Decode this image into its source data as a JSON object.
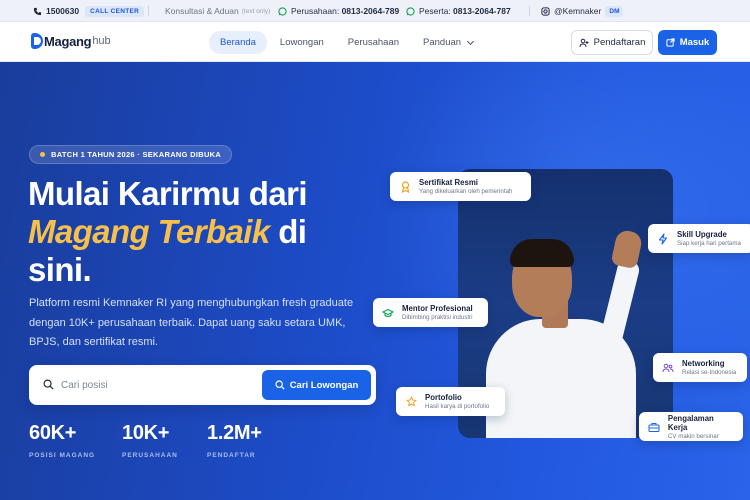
{
  "topbar": {
    "phone": "1500630",
    "call_center": "CALL CENTER",
    "consult": "Konsultasi & Aduan",
    "consult_note": "(text only)",
    "company_label": "Perusahaan:",
    "company_phone": "0813-2064-789",
    "participant_label": "Peserta:",
    "participant_phone": "0813-2064-787",
    "instagram": "@Kemnaker",
    "dm": "DM"
  },
  "navbar": {
    "logo_main": "Magang",
    "logo_sub": "hub",
    "links": [
      "Beranda",
      "Lowongan",
      "Perusahaan",
      "Panduan"
    ],
    "register": "Pendaftaran",
    "login": "Masuk"
  },
  "hero": {
    "pill": "BATCH 1 TAHUN 2026 · SEKARANG DIBUKA",
    "headline_1": "Mulai Karirmu dari",
    "headline_accent": "Magang Terbaik",
    "headline_2": "di",
    "headline_3": "sini.",
    "description": "Platform resmi Kemnaker RI yang menghubungkan fresh graduate dengan 10K+ perusahaan terbaik. Dapat uang saku setara UMK, BPJS, dan sertifikat resmi.",
    "search_placeholder": "Cari posisi",
    "search_button": "Cari Lowongan",
    "stats": [
      {
        "value": "60K+",
        "label": "POSISI MAGANG"
      },
      {
        "value": "10K+",
        "label": "PERUSAHAAN"
      },
      {
        "value": "1.2M+",
        "label": "PENDAFTAR"
      }
    ]
  },
  "chips": [
    {
      "title": "Sertifikat Resmi",
      "sub": "Yang dikeluarkan oleh pemerintah",
      "icon": "award-icon",
      "color": "#e7a21a"
    },
    {
      "title": "Skill Upgrade",
      "sub": "Siap kerja hari pertama",
      "icon": "lightning-icon",
      "color": "#1b63e6"
    },
    {
      "title": "Mentor Profesional",
      "sub": "Dibimbing praktisi industri",
      "icon": "graduation-cap-icon",
      "color": "#14a05a"
    },
    {
      "title": "Networking",
      "sub": "Relasi se-Indonesia",
      "icon": "users-icon",
      "color": "#7b4fd6"
    },
    {
      "title": "Portofolio",
      "sub": "Hasil karya di portofolio",
      "icon": "star-icon",
      "color": "#e7a21a"
    },
    {
      "title": "Pengalaman Kerja",
      "sub": "CV makin bersinar",
      "icon": "briefcase-icon",
      "color": "#1b63e6"
    }
  ],
  "colors": {
    "primary": "#1b63e6",
    "accent": "#f7c04a",
    "hero_bg": "#1d4cc8"
  }
}
